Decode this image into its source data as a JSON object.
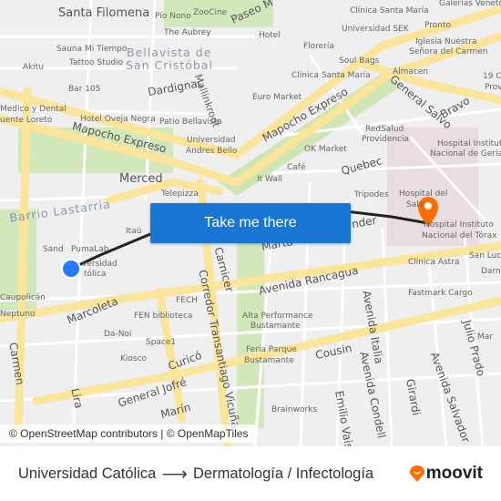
{
  "map": {
    "labels": [
      "Santa Filomena",
      "Pío Nono",
      "ZooCine",
      "Paseo M",
      "The Aubrey",
      "Sauna Mi Tiempo",
      "Bellavista de",
      "San Cristóbal",
      "Tattoo Studio",
      "Akitu",
      "Bar 105",
      "Dardignac",
      "Mallinkrodt",
      "Medico y Dental",
      "uente Loreto",
      "Hotel Oveja Negra",
      "Patio Bellavista",
      "Mapocho Expreso",
      "Universidad",
      "Andres Bello",
      "Merced",
      "Telepizza",
      "Barrio Lastarria",
      "Clínica Santa María",
      "Universidad SEK",
      "Hotel",
      "Florería",
      "Soul Bags",
      "Clínica Santa María",
      "Euro Market",
      "Mapocho Expreso",
      "Pronto",
      "Iglesia Nuestra",
      "Señora del Carmen",
      "Almacen",
      "General Salvo",
      "Bravo",
      "RedSalud",
      "Providencia",
      "OK Market",
      "Hospital Instituto",
      "Nacional de Geriatr",
      "Café",
      "It Wall",
      "Quebec",
      "Tripodes",
      "Hospital del",
      "Salv",
      "Hospital Instituto",
      "Nacional del Tórax",
      "Galerías Veneto",
      "19 Co",
      "Prov",
      "Sand",
      "PumaLab",
      "Itaú",
      "versidad",
      "tólica",
      "Caupolicán",
      "Neptuno",
      "Marcoleta",
      "Da-Noi",
      "FECH",
      "FEN biblioteca",
      "Carnicer",
      "Corredor Transantiago Vicuña",
      "Avenida Rancagua",
      "Alta Performance",
      "Bustamante",
      "Clínica Astra",
      "San Lucas",
      "Darna",
      "Fastmark Cargo",
      "Space1",
      "Kiosco",
      "Curicó",
      "Feria Parque",
      "Bustamante",
      "Cousin",
      "Avenida Italia",
      "Avenida Condell",
      "Emilio Vaisse",
      "Girardi",
      "Julio Prado",
      "Avenida Salvador",
      "General Jofré",
      "Marín",
      "Brainworks",
      "Carmen",
      "Lira",
      "Mar",
      "Marta",
      "nder"
    ],
    "cta_label": "Take me there",
    "attribution": "© OpenStreetMap contributors | © OpenMapTiles",
    "colors": {
      "origin": "#2979ff",
      "destination": "#ff6d00",
      "route": "#222222",
      "button": "#1976d2",
      "major_road": "#fbe59a",
      "park": "#cfe8b5"
    }
  },
  "footer": {
    "origin": "Universidad Católica",
    "destination": "Dermatología / Infectología",
    "brand": "moovit"
  }
}
